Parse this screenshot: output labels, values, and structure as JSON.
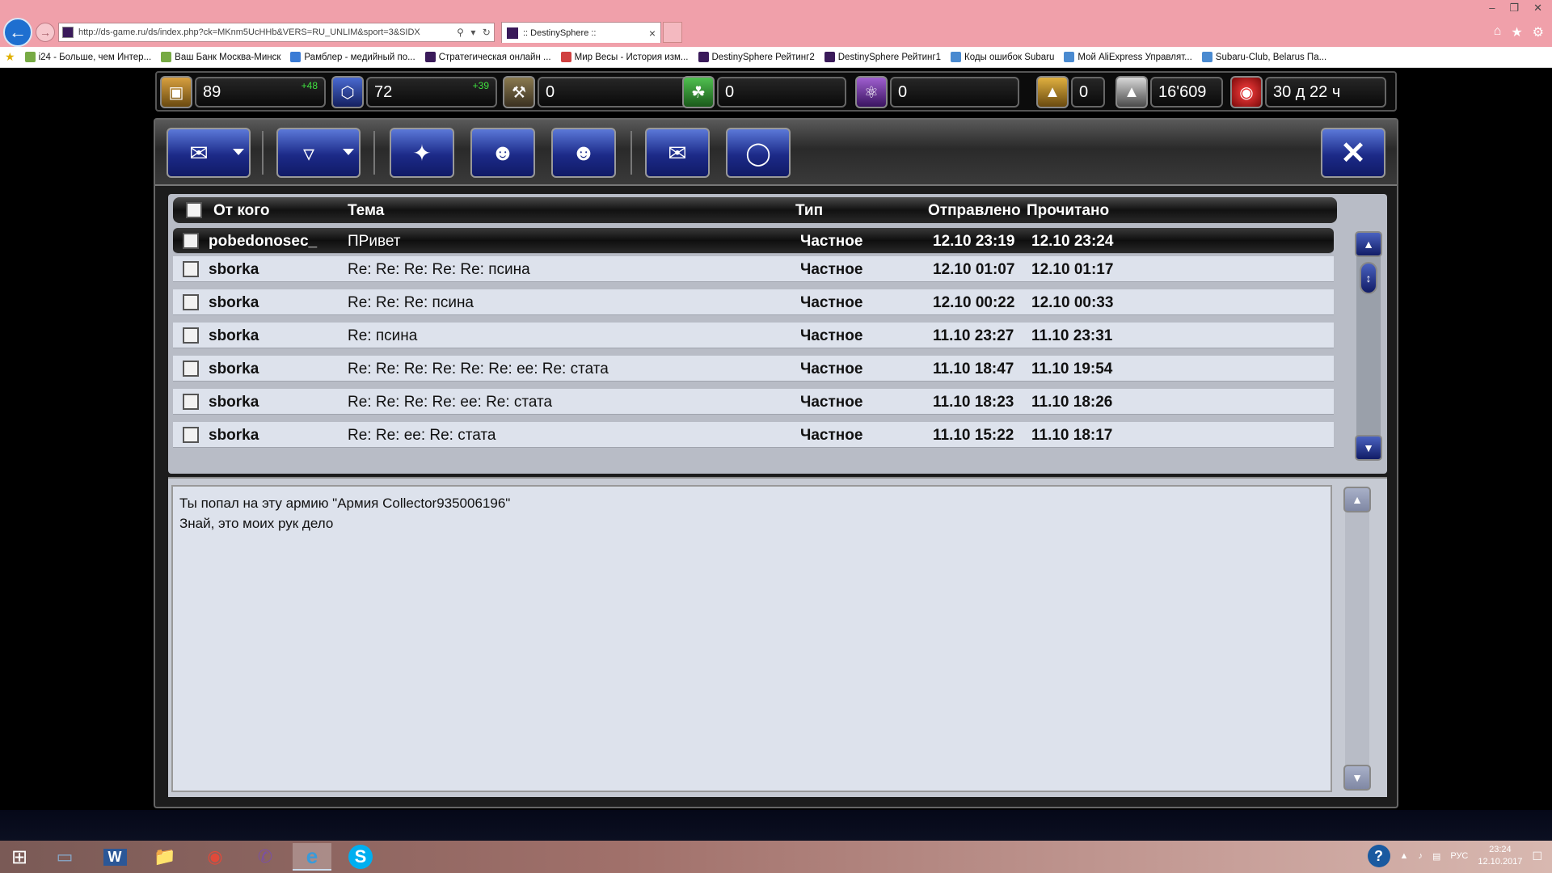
{
  "browser": {
    "url": "http://ds-game.ru/ds/index.php?ck=MKnm5UcHHb&VERS=RU_UNLIM&sport=3&SIDX",
    "tab_title": ":: DestinySphere ::",
    "bookmarks": [
      "i24 - Больше, чем Интер...",
      "Ваш Банк Москва-Минск",
      "Рамблер - медийный по...",
      "Стратегическая онлайн ...",
      "Мир Весы - История изм...",
      "DestinySphere  Рейтинг2",
      "DestinySphere  Рейтинг1",
      "Коды ошибок Subaru",
      "Мой AliExpress Управлят...",
      "Subaru-Club, Belarus  Па..."
    ]
  },
  "resources": [
    {
      "icon": "cube-icon",
      "value": "89",
      "delta": "+48"
    },
    {
      "icon": "crystal-icon",
      "value": "72",
      "delta": "+39"
    },
    {
      "icon": "tool-icon",
      "value": "0",
      "delta": ""
    },
    {
      "icon": "wheat-icon",
      "value": "0",
      "delta": ""
    },
    {
      "icon": "atom-icon",
      "value": "0",
      "delta": ""
    }
  ],
  "stats": [
    {
      "icon": "ship-gold-icon",
      "value": "0"
    },
    {
      "icon": "ship-silver-icon",
      "value": "16'609"
    },
    {
      "icon": "timer-icon",
      "value": "30 д 22 ч"
    }
  ],
  "table": {
    "headers": {
      "from": "От кого",
      "subject": "Тема",
      "type": "Тип",
      "sent": "Отправлено",
      "read": "Прочитано"
    },
    "rows": [
      {
        "from": "pobedonosec_",
        "subject": "ПРивет",
        "type": "Частное",
        "sent": "12.10 23:19",
        "read": "12.10 23:24"
      },
      {
        "from": "sborka",
        "subject": "Re: Re: Re: Re: Re: псина",
        "type": "Частное",
        "sent": "12.10 01:07",
        "read": "12.10 01:17"
      },
      {
        "from": "sborka",
        "subject": "Re: Re: Re: псина",
        "type": "Частное",
        "sent": "12.10 00:22",
        "read": "12.10 00:33"
      },
      {
        "from": "sborka",
        "subject": "Re: псина",
        "type": "Частное",
        "sent": "11.10 23:27",
        "read": "11.10 23:31"
      },
      {
        "from": "sborka",
        "subject": "Re: Re: Re: Re: Re: Re: ee: Re: стата",
        "type": "Частное",
        "sent": "11.10 18:47",
        "read": "11.10 19:54"
      },
      {
        "from": "sborka",
        "subject": "Re: Re: Re: Re: ee: Re: стата",
        "type": "Частное",
        "sent": "11.10 18:23",
        "read": "11.10 18:26"
      },
      {
        "from": "sborka",
        "subject": "Re: Re: ee: Re: стата",
        "type": "Частное",
        "sent": "11.10 15:22",
        "read": "11.10 18:17"
      }
    ]
  },
  "message": {
    "line1": "Ты попал на эту армию \"Армия Collector935006196\"",
    "line2": "Знай, это моих рук дело"
  },
  "taskbar": {
    "lang": "РУС",
    "time": "23:24",
    "date": "12.10.2017"
  }
}
